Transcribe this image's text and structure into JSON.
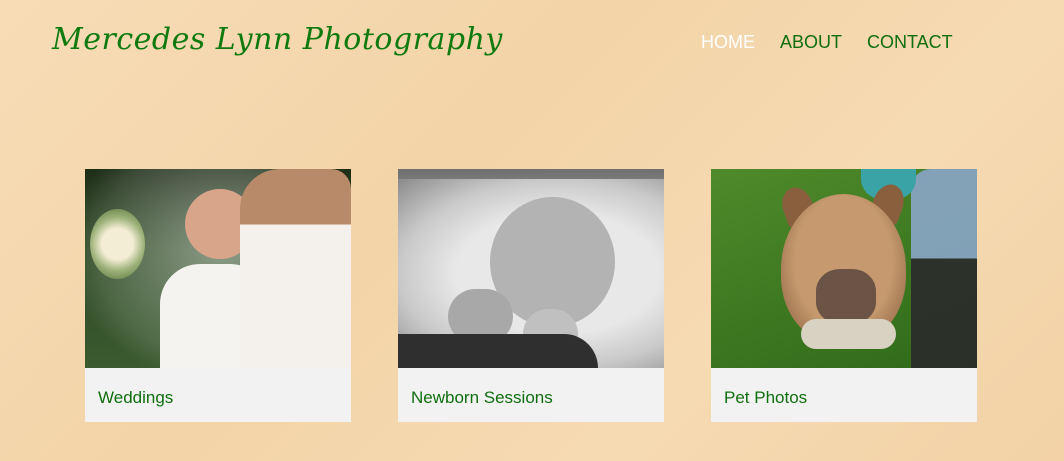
{
  "header": {
    "site_title": "Mercedes Lynn Photography"
  },
  "nav": {
    "items": [
      {
        "label": "HOME",
        "active": true
      },
      {
        "label": "ABOUT",
        "active": false
      },
      {
        "label": "CONTACT",
        "active": false
      }
    ]
  },
  "gallery": {
    "cards": [
      {
        "label": "Weddings"
      },
      {
        "label": "Newborn Sessions"
      },
      {
        "label": "Pet Photos"
      }
    ]
  },
  "colors": {
    "brand_green": "#0f7a0f",
    "nav_active": "#ffffff",
    "card_bg": "#f2f2f2"
  }
}
